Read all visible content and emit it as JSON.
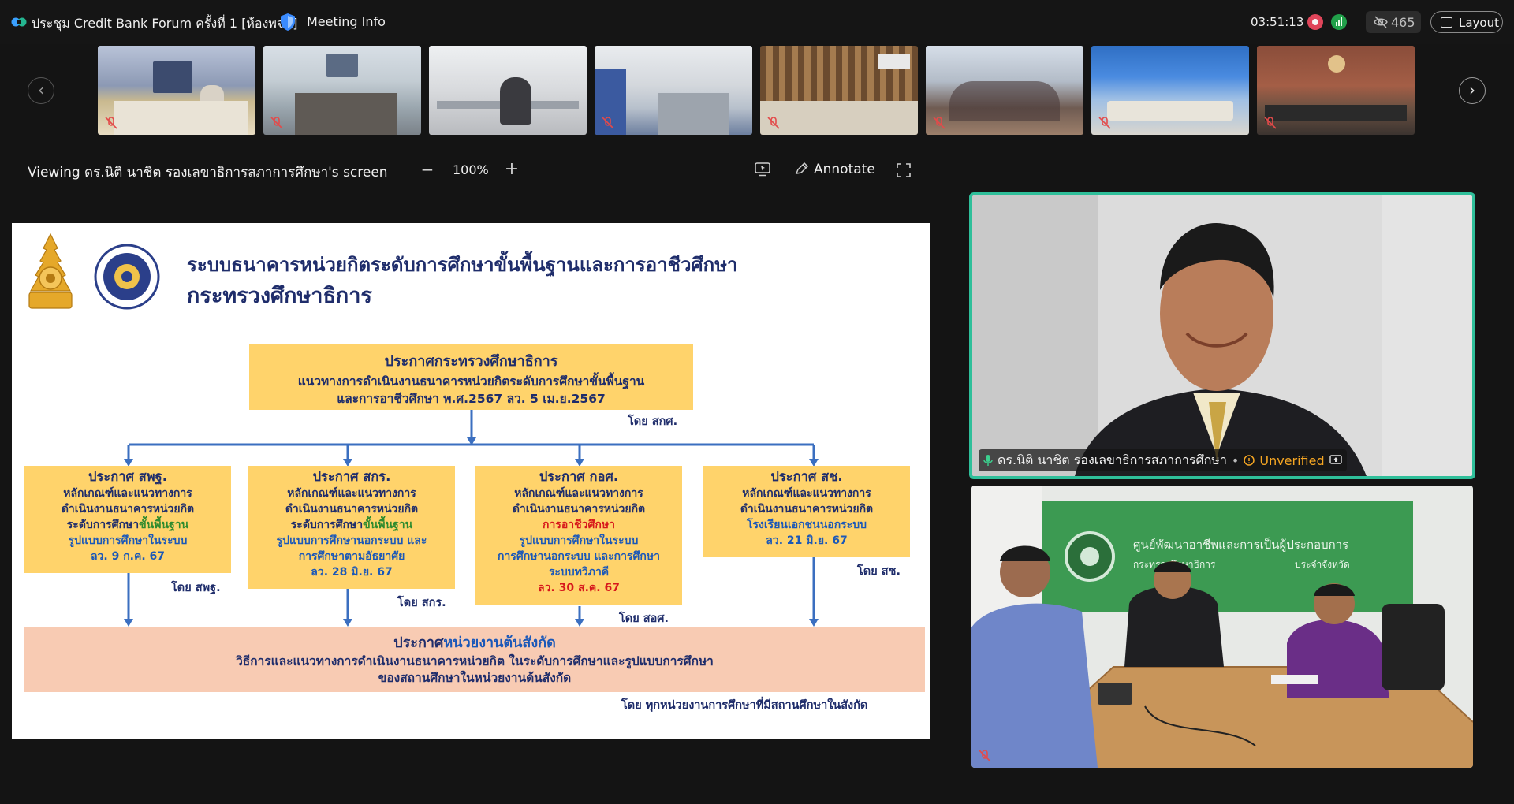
{
  "titlebar": {
    "meeting_title": "ประชุม Credit Bank Forum ครั้งที่ 1 [ห้องพจน์]",
    "meeting_info_label": "Meeting Info",
    "timer": "03:51:13",
    "participant_count": "465",
    "layout_label": "Layout"
  },
  "share_bar": {
    "viewing_label": "Viewing ดร.นิติ นาชิต รองเลขาธิการสภาการศึกษา's screen",
    "zoom_level": "100%",
    "zoom_minus": "−",
    "zoom_plus": "+",
    "annotate_label": "Annotate"
  },
  "filmstrip": {
    "prev": "‹",
    "next": "›"
  },
  "slide": {
    "title_line1": "ระบบธนาคารหน่วยกิตระดับการศึกษาขั้นพื้นฐานและการอาชีวศึกษา",
    "title_line2": "กระทรวงศึกษาธิการ",
    "main_heading": "ประกาศกระทรวงศึกษาธิการ",
    "main_line1": "แนวทางการดำเนินงานธนาคารหน่วยกิตระดับการศึกษาขั้นพื้นฐาน",
    "main_line2": "และการอาชีวศึกษา พ.ศ.2567 ลว. 5 เม.ย.2567",
    "main_by": "โดย สกศ.",
    "box1": {
      "heading": "ประกาศ สพฐ.",
      "l1": "หลักเกณฑ์และแนวทางการ",
      "l2": "ดำเนินงานธนาคารหน่วยกิต",
      "l3a": "ระดับการศึกษา",
      "l3b": "ขั้นพื้นฐาน",
      "l4": "รูปแบบการศึกษาในระบบ",
      "l5": "ลว. 9 ก.ค. 67",
      "by": "โดย สพฐ."
    },
    "box2": {
      "heading": "ประกาศ สกร.",
      "l1": "หลักเกณฑ์และแนวทางการ",
      "l2": "ดำเนินงานธนาคารหน่วยกิต",
      "l3a": "ระดับการศึกษา",
      "l3b": "ขั้นพื้นฐาน",
      "l4": "รูปแบบการศึกษานอกระบบ และ",
      "l5": "การศึกษาตามอัธยาศัย",
      "l6": "ลว. 28 มิ.ย. 67",
      "by": "โดย สกร."
    },
    "box3": {
      "heading": "ประกาศ กอศ.",
      "l1": "หลักเกณฑ์และแนวทางการ",
      "l2": "ดำเนินงานธนาคารหน่วยกิต",
      "l3": "การอาชีวศึกษา",
      "l4": "รูปแบบการศึกษาในระบบ",
      "l5": "การศึกษานอกระบบ และการศึกษา",
      "l6": "ระบบทวิภาคี",
      "l7": "ลว. 30 ส.ค. 67",
      "by": "โดย สอศ."
    },
    "box4": {
      "heading": "ประกาศ สช.",
      "l1": "หลักเกณฑ์และแนวทางการ",
      "l2": "ดำเนินงานธนาคารหน่วยกิต",
      "l3": "โรงเรียนเอกชนนอกระบบ",
      "l4": "ลว. 21 มิ.ย. 67",
      "by": "โดย สช."
    },
    "bottom_heading_a": "ประกาศ",
    "bottom_heading_b": "หน่วยงานต้นสังกัด",
    "bottom_line1": "วิธีการและแนวทางการดำเนินงานธนาคารหน่วยกิต ในระดับการศึกษาและรูปแบบการศึกษา",
    "bottom_line2": "ของสถานศึกษาในหน่วยงานต้นสังกัด",
    "bottom_by": "โดย ทุกหน่วยงานการศึกษาที่มีสถานศึกษาในสังกัด"
  },
  "speaker_tile": {
    "name": "ดร.นิติ นาชิต รองเลขาธิการสภาการศึกษา",
    "separator": "•",
    "status": "Unverified"
  },
  "room_tile": {
    "sign_line1": "ศูนย์พัฒนาอาชีพและการเป็นผู้ประกอบการ",
    "sign_line2": "กระทรวงศึกษาธิการ",
    "sign_line3": "ประจำจังหวัด"
  },
  "colors": {
    "accent_green": "#2fbf9a",
    "rec_red": "#e0455a",
    "signal_green": "#21a04a",
    "unverified_orange": "#f5a623",
    "slide_yellow": "#ffd36b",
    "slide_peach": "#f8cbb3",
    "slide_navy": "#1f2d6b"
  }
}
